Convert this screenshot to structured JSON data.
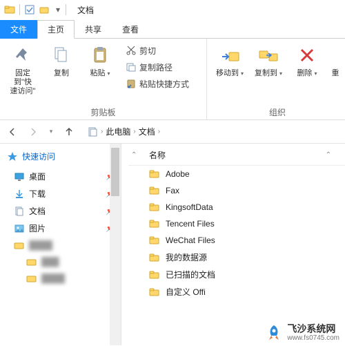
{
  "title": "文档",
  "tabs": {
    "file": "文件",
    "home": "主页",
    "share": "共享",
    "view": "查看"
  },
  "ribbon": {
    "pin": "固定到\"快\n速访问\"",
    "copy": "复制",
    "paste": "粘贴",
    "cut": "剪切",
    "copypath": "复制路径",
    "paste_shortcut": "粘贴快捷方式",
    "clipboard_group": "剪贴板",
    "moveto": "移动到",
    "copyto": "复制到",
    "delete": "删除",
    "rename_partial": "重",
    "organize_group": "组织"
  },
  "breadcrumb": {
    "pc": "此电脑",
    "docs": "文档"
  },
  "sidebar": {
    "quick": "快速访问",
    "items": [
      {
        "label": "桌面"
      },
      {
        "label": "下载"
      },
      {
        "label": "文档"
      },
      {
        "label": "图片"
      }
    ]
  },
  "content": {
    "name_header": "名称",
    "items": [
      {
        "label": "Adobe"
      },
      {
        "label": "Fax"
      },
      {
        "label": "KingsoftData"
      },
      {
        "label": "Tencent Files"
      },
      {
        "label": "WeChat Files"
      },
      {
        "label": "我的数据源"
      },
      {
        "label": "已扫描的文档"
      },
      {
        "label": "自定义 Offi"
      }
    ]
  },
  "watermark": {
    "main": "飞沙系统网",
    "sub": "www.fs0745.com"
  }
}
